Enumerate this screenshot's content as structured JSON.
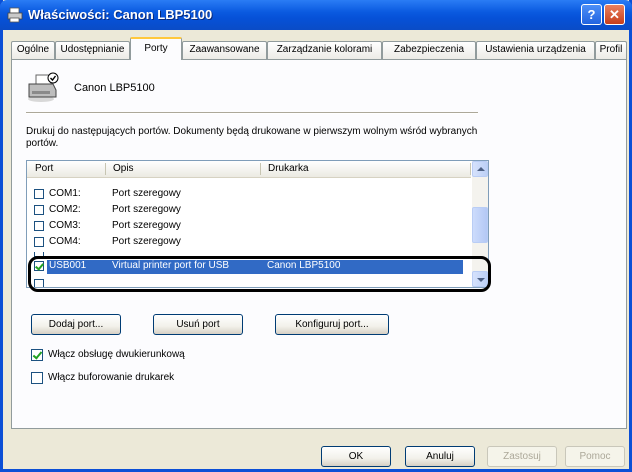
{
  "window": {
    "title": "Właściwości: Canon LBP5100",
    "help_label": "?",
    "close_label": "✕",
    "icon": "printer-icon"
  },
  "tabs": [
    {
      "label": "Ogólne"
    },
    {
      "label": "Udostępnianie"
    },
    {
      "label": "Porty"
    },
    {
      "label": "Zaawansowane"
    },
    {
      "label": "Zarządzanie kolorami"
    },
    {
      "label": "Zabezpieczenia"
    },
    {
      "label": "Ustawienia urządzenia"
    },
    {
      "label": "Profil"
    }
  ],
  "active_tab": "Porty",
  "printer": {
    "name": "Canon LBP5100"
  },
  "description": "Drukuj do następujących portów. Dokumenty będą drukowane w pierwszym wolnym wśród wybranych portów.",
  "ports_table": {
    "columns": [
      "Port",
      "Opis",
      "Drukarka"
    ],
    "rows": [
      {
        "port": "COM1:",
        "desc": "Port szeregowy",
        "printer": "",
        "checked": false,
        "selected": false
      },
      {
        "port": "COM2:",
        "desc": "Port szeregowy",
        "printer": "",
        "checked": false,
        "selected": false
      },
      {
        "port": "COM3:",
        "desc": "Port szeregowy",
        "printer": "",
        "checked": false,
        "selected": false
      },
      {
        "port": "COM4:",
        "desc": "Port szeregowy",
        "printer": "",
        "checked": false,
        "selected": false
      },
      {
        "port": "USB001",
        "desc": "Virtual printer port for USB",
        "printer": "Canon LBP5100",
        "checked": true,
        "selected": true
      }
    ]
  },
  "buttons": {
    "add_port": "Dodaj port...",
    "delete_port": "Usuń port",
    "configure_port": "Konfiguruj port...",
    "ok": "OK",
    "cancel": "Anuluj",
    "apply": "Zastosuj",
    "help": "Pomoc"
  },
  "options": {
    "bidirectional": {
      "label": "Włącz obsługę dwukierunkową",
      "checked": true
    },
    "pooling": {
      "label": "Włącz buforowanie drukarek",
      "checked": false
    }
  },
  "colors": {
    "title_bar": "#0a5ae0",
    "selection": "#316ac5",
    "window_bg": "#ece9d8"
  }
}
